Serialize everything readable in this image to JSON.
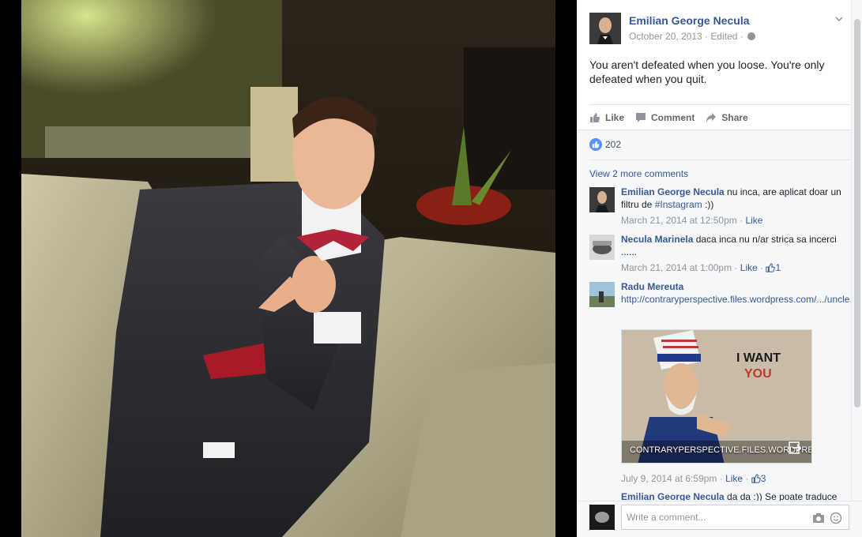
{
  "post": {
    "author": "Emilian George Necula",
    "date": "October 20, 2013",
    "edited": "Edited",
    "meta_separator": " · ",
    "text": "You aren't defeated when you loose. You're only defeated when you quit.",
    "actions": {
      "like": "Like",
      "comment": "Comment",
      "share": "Share"
    },
    "like_count": "202"
  },
  "comments": {
    "view_more": "View 2 more comments",
    "items": [
      {
        "name": "Emilian George Necula",
        "text": " nu inca, are aplicat doar un filtru de ",
        "hashtag": "#Instagram",
        "text_after": " :))",
        "timestamp": "March 21, 2014 at 12:50pm",
        "like": "Like"
      },
      {
        "name": "Necula Marinela",
        "text": " daca inca nu n/ar strica sa incerci ......",
        "timestamp": "March 21, 2014 at 1:00pm",
        "like": "Like",
        "reactions": "1"
      },
      {
        "name": "Radu Mereuta",
        "link": "http://contraryperspective.files.wordpress.com/.../uncle...",
        "preview_title_line1": "I WANT",
        "preview_title_line2": "YOU",
        "preview_caption": "CONTRARYPERSPECTIVE.FILES.WORDPRESS",
        "timestamp": "July 9, 2014 at 6:59pm",
        "like": "Like",
        "reactions": "3"
      },
      {
        "name": "Emilian George Necula",
        "text": " da da :)) Se poate traduce"
      }
    ]
  },
  "composer": {
    "placeholder": "Write a comment..."
  },
  "colors": {
    "link": "#365899",
    "meta": "#90949c",
    "like_badge": "#5890ff"
  },
  "icons": [
    "chevron-down-icon",
    "globe-icon",
    "like-icon",
    "comment-icon",
    "share-icon",
    "camera-icon",
    "smile-icon",
    "open-link-icon"
  ]
}
